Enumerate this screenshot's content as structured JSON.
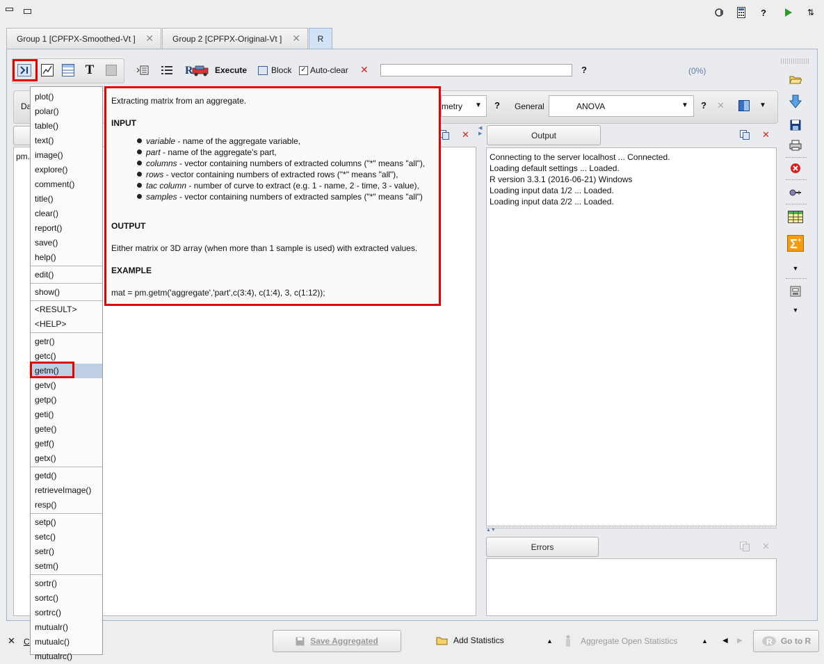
{
  "tabs": [
    {
      "label": "Group 1 [CPFPX-Smoothed-Vt ]"
    },
    {
      "label": "Group 2 [CPFPX-Original-Vt ]"
    },
    {
      "label": "R"
    }
  ],
  "toolbar": {
    "execute_label": "Execute",
    "block_label": "Block",
    "autoclear_label": "Auto-clear",
    "help_mark": "?",
    "progress": "(0%)"
  },
  "row2": {
    "left_partial": "Da",
    "metry_partial": "metry",
    "help_mark": "?",
    "general_label": "General",
    "general_value": "ANOVA"
  },
  "editor": {
    "partial_text": "pm."
  },
  "menu": {
    "groups": [
      [
        "plot()",
        "polar()",
        "table()",
        "text()",
        "image()",
        "explore()",
        "comment()",
        "title()",
        "clear()",
        "report()",
        "save()",
        "help()"
      ],
      [
        "edit()"
      ],
      [
        "show()"
      ],
      [
        "<RESULT>",
        "<HELP>"
      ],
      [
        "getr()",
        "getc()",
        "getm()",
        "getv()",
        "getp()",
        "geti()",
        "gete()",
        "getf()",
        "getx()"
      ],
      [
        "getd()",
        "retrieveImage()",
        "resp()"
      ],
      [
        "setp()",
        "setc()",
        "setr()",
        "setm()"
      ],
      [
        "sortr()",
        "sortc()",
        "sortrc()",
        "mutualr()",
        "mutualc()",
        "mutualrc()"
      ]
    ],
    "selected": "getm()"
  },
  "tooltip": {
    "intro": "Extracting matrix from an aggregate.",
    "input_heading": "INPUT",
    "params": [
      {
        "name": "variable",
        "desc": " - name of the aggregate variable,"
      },
      {
        "name": "part",
        "desc": " - name of the aggregate's part,"
      },
      {
        "name": "columns",
        "desc": " - vector containing numbers of extracted columns (\"*\" means \"all\"),"
      },
      {
        "name": "rows",
        "desc": " - vector containing numbers of extracted rows (\"*\" means \"all\"),"
      },
      {
        "name": "tac column",
        "desc": " - number of curve to extract (e.g. 1 - name, 2 - time, 3 - value),"
      },
      {
        "name": "samples",
        "desc": " - vector containing numbers of extracted samples (\"*\" means \"all\")"
      }
    ],
    "output_heading": "OUTPUT",
    "output_text": "Either matrix or 3D array (when more than 1 sample is used) with extracted values.",
    "example_heading": "EXAMPLE",
    "example_code": "mat = pm.getm('aggregate','part',c(3:4), c(1:4), 3, c(1:12));"
  },
  "output_panel": {
    "title": "Output",
    "lines": [
      "Connecting to the server localhost ... Connected.",
      "Loading default settings ... Loaded.",
      "R version 3.3.1 (2016-06-21) Windows",
      "Loading input data 1/2 ... Loaded.",
      "Loading input data 2/2 ... Loaded."
    ]
  },
  "errors_panel": {
    "title": "Errors"
  },
  "bottom": {
    "left_partial": "C",
    "save_aggregated": "Save Aggregated",
    "add_statistics": "Add Statistics",
    "aggregate_open_statistics": "Aggregate Open Statistics",
    "go_to_r": "Go to R"
  },
  "colors": {
    "highlight_red": "#e60000",
    "menu_selected": "#bfcfe3",
    "active_tab": "#d3e3f7"
  }
}
